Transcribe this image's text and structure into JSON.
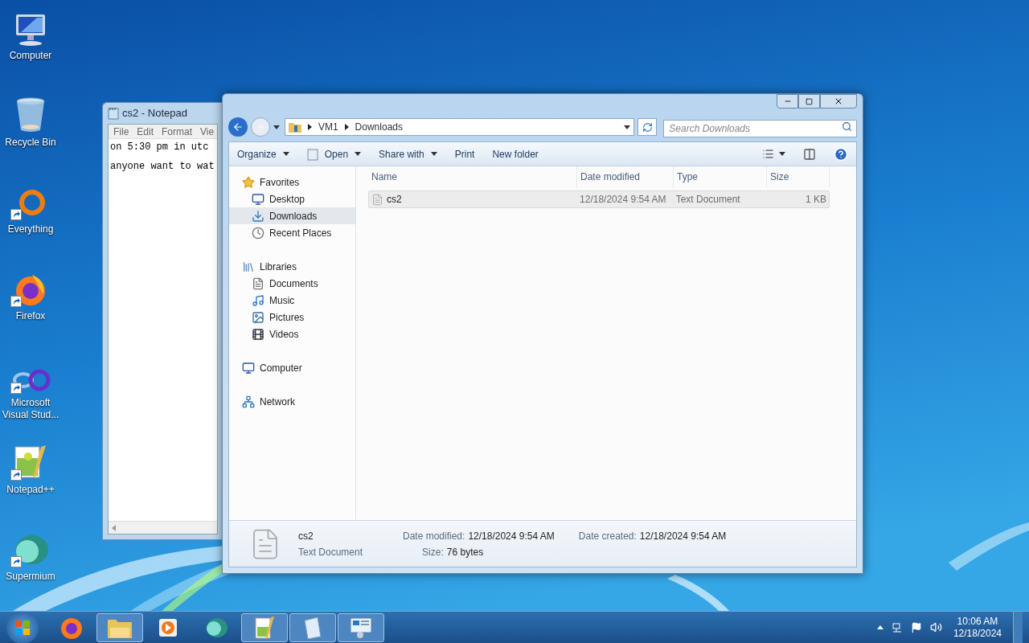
{
  "desktop_icons": [
    {
      "label": "Computer",
      "shortcut": false
    },
    {
      "label": "Recycle Bin",
      "shortcut": false
    },
    {
      "label": "Everything",
      "shortcut": true
    },
    {
      "label": "Firefox",
      "shortcut": true
    },
    {
      "label": "Microsoft Visual Stud...",
      "shortcut": true
    },
    {
      "label": "Notepad++",
      "shortcut": true
    },
    {
      "label": "Supermium",
      "shortcut": true
    }
  ],
  "notepad": {
    "title": "cs2 - Notepad",
    "menu": [
      "File",
      "Edit",
      "Format",
      "Vie"
    ],
    "lines": [
      "on 5:30 pm in utc",
      "anyone want to wat"
    ]
  },
  "explorer": {
    "breadcrumb": [
      "VM1",
      "Downloads"
    ],
    "search": {
      "placeholder": "Search Downloads"
    },
    "toolbar": [
      {
        "label": "Organize",
        "kind": "menu"
      },
      {
        "label": "Open",
        "kind": "menu"
      },
      {
        "label": "Share with",
        "kind": "menu"
      },
      {
        "label": "Print",
        "kind": "button"
      },
      {
        "label": "New folder",
        "kind": "button"
      }
    ],
    "nav": [
      {
        "label": "Favorites",
        "selected": false,
        "children": [
          {
            "label": "Desktop",
            "selected": false
          },
          {
            "label": "Downloads",
            "selected": true
          },
          {
            "label": "Recent Places",
            "selected": false
          }
        ]
      },
      {
        "label": "Libraries",
        "selected": false,
        "children": [
          {
            "label": "Documents",
            "selected": false
          },
          {
            "label": "Music",
            "selected": false
          },
          {
            "label": "Pictures",
            "selected": false
          },
          {
            "label": "Videos",
            "selected": false
          }
        ]
      },
      {
        "label": "Computer",
        "selected": false
      },
      {
        "label": "Network",
        "selected": false
      }
    ],
    "columns": [
      "Name",
      "Date modified",
      "Type",
      "Size"
    ],
    "rows": [
      {
        "cells": [
          "cs2",
          "12/18/2024 9:54 AM",
          "Text Document",
          "1 KB"
        ],
        "selected": true
      }
    ],
    "details": {
      "name": "cs2",
      "type": "Text Document",
      "fields": [
        {
          "label": "Date modified:",
          "value": "12/18/2024 9:54 AM"
        },
        {
          "label": "Size:",
          "value": "76 bytes"
        },
        {
          "label": "Date created:",
          "value": "12/18/2024 9:54 AM"
        }
      ]
    }
  },
  "taskbar": {
    "items": [
      {
        "running": false
      },
      {
        "running": true
      },
      {
        "running": false
      },
      {
        "running": false
      },
      {
        "running": true
      },
      {
        "running": true
      },
      {
        "running": true
      }
    ],
    "time": "10:06 AM",
    "date": "12/18/2024"
  }
}
